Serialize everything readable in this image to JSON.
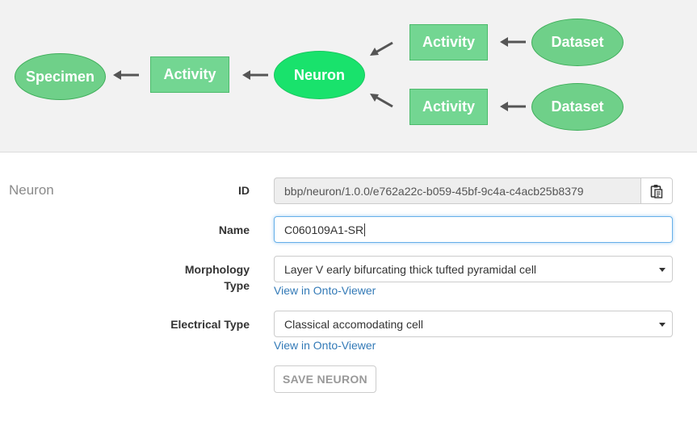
{
  "diagram": {
    "nodes": {
      "specimen": "Specimen",
      "activity_left": "Activity",
      "neuron": "Neuron",
      "activity_top": "Activity",
      "dataset_top": "Dataset",
      "activity_bottom": "Activity",
      "dataset_bottom": "Dataset"
    },
    "colors": {
      "node_fill": "#6fd089",
      "focus_fill": "#19e26c",
      "activity_fill": "#73d692",
      "arrow": "#555555"
    }
  },
  "form": {
    "section_title": "Neuron",
    "id_label": "ID",
    "id_value": "bbp/neuron/1.0.0/e762a22c-b059-45bf-9c4a-c4acb25b8379",
    "name_label": "Name",
    "name_value": "C060109A1-SR",
    "morphology_label_line1": "Morphology",
    "morphology_label_line2": "Type",
    "morphology_value": "Layer V early bifurcating thick tufted pyramidal cell",
    "morphology_link": "View in Onto-Viewer",
    "electrical_label": "Electrical Type",
    "electrical_value": "Classical accomodating cell",
    "electrical_link": "View in Onto-Viewer",
    "save_button": "SAVE NEURON"
  },
  "icons": {
    "copy": "clipboard-icon",
    "select_caret": "caret-down-icon",
    "arrow": "arrow-left-icon"
  }
}
